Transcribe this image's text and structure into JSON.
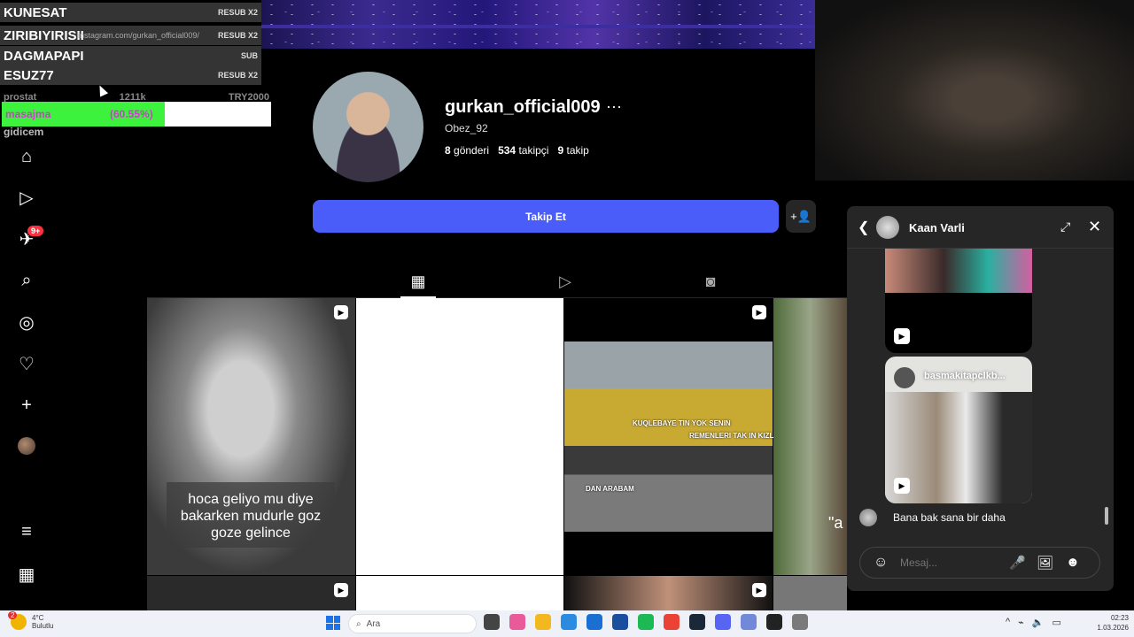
{
  "overlay": {
    "rows": [
      {
        "name": "KUNESAT",
        "tag": "RESUB X2"
      },
      {
        "name": "ZIRIBIYIRISII",
        "tag": "RESUB X2"
      },
      {
        "name": "DAGMAPAPI",
        "tag": "SUB"
      },
      {
        "name": "ESUZ77",
        "tag": "RESUB X2"
      }
    ],
    "url": "instagram.com/gurkan_official009/",
    "meta_left": "prostat",
    "meta_mid": "1211k",
    "meta_right": "TRY2000",
    "bar_label": "masajma",
    "bar_pct_text": "(60.55%)",
    "bar_fraction": 0.6055,
    "footer": "gidicem"
  },
  "nav": {
    "items": [
      {
        "name": "home-icon",
        "glyph": "⌂"
      },
      {
        "name": "reels-icon",
        "glyph": "▷"
      },
      {
        "name": "messages-icon",
        "glyph": "✈"
      },
      {
        "name": "search-icon",
        "glyph": "⌕"
      },
      {
        "name": "explore-icon",
        "glyph": "◎"
      },
      {
        "name": "notifications-icon",
        "glyph": "♡"
      },
      {
        "name": "create-icon",
        "glyph": "+"
      },
      {
        "name": "menu-icon",
        "glyph": "≡"
      },
      {
        "name": "apps-icon",
        "glyph": "▦"
      }
    ],
    "badge": "9+"
  },
  "profile": {
    "username": "gurkan_official009",
    "more": "···",
    "handle": "Obez_92",
    "posts_count": "8",
    "posts_label": "gönderi",
    "followers_count": "534",
    "followers_label": "takipçi",
    "following_count": "9",
    "following_label": "takip",
    "follow_button": "Takip Et",
    "add_user_glyph": "+👤"
  },
  "tabs": [
    {
      "name": "posts-grid-icon",
      "glyph": "▦",
      "active": true
    },
    {
      "name": "reels-tab-icon",
      "glyph": "▷",
      "active": false
    },
    {
      "name": "tagged-icon",
      "glyph": "◙",
      "active": false
    }
  ],
  "grid": {
    "caption1": "hoca geliyo mu diye bakarken mudurle goz goze gelince",
    "bus_caption_1": "KUQLEBAYE TIN YOK SENIN",
    "bus_caption_2": "REMENLERI TAK IN KIZLAR GIDIYORUZ",
    "bus_caption_3": "DAN ARABAM",
    "edge_text": "\"a"
  },
  "dm": {
    "contact": "Kaan Varli",
    "shared_source": "basmakitapclkb...",
    "last_message": "Bana bak sana bir daha",
    "input_placeholder": "Mesaj..."
  },
  "taskbar": {
    "temperature": "4°C",
    "weather": "Bulutlu",
    "weather_badge": "2",
    "search_label": "Ara",
    "time": "02:23",
    "date": "1.03.2026",
    "colors": [
      "#444444",
      "#e85a9a",
      "#f3b820",
      "#2b8be0",
      "#1a6fd0",
      "#1a4fa0",
      "#1db954",
      "#ea4335",
      "#1b2838",
      "#5865f2",
      "#7289da",
      "#222222",
      "#7a7a7a"
    ]
  }
}
